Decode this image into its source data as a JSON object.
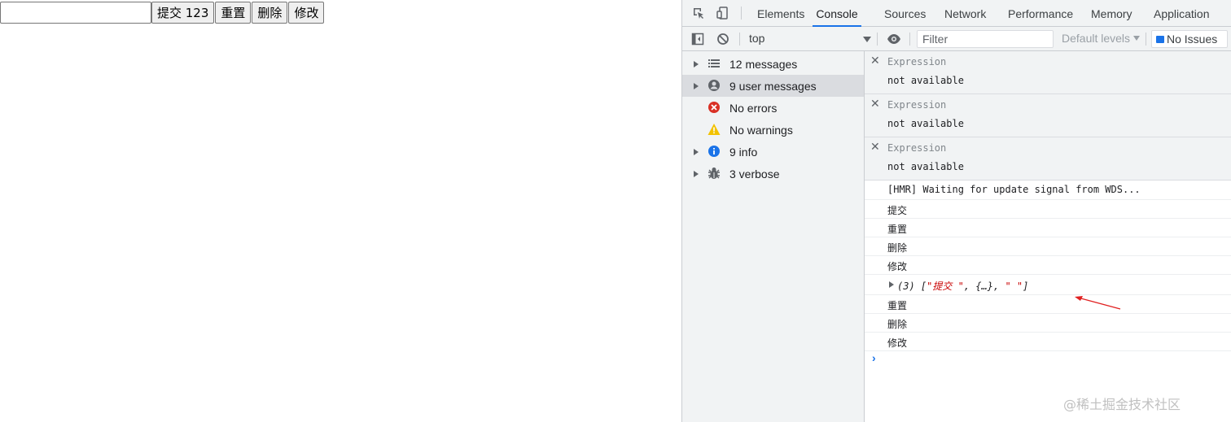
{
  "page": {
    "input_value": "",
    "buttons": [
      "提交 123",
      "重置",
      "删除",
      "修改"
    ]
  },
  "devtools": {
    "tabs": [
      "Elements",
      "Console",
      "Sources",
      "Network",
      "Performance",
      "Memory",
      "Application"
    ],
    "active_tab": "Console",
    "context": "top",
    "filter_placeholder": "Filter",
    "levels_label": "Default levels",
    "issues_label": "No Issues",
    "sidebar": [
      {
        "label": "12 messages",
        "icon": "list-icon",
        "expandable": true
      },
      {
        "label": "9 user messages",
        "icon": "user-icon",
        "expandable": true
      },
      {
        "label": "No errors",
        "icon": "error-icon",
        "expandable": false
      },
      {
        "label": "No warnings",
        "icon": "warning-icon",
        "expandable": false
      },
      {
        "label": "9 info",
        "icon": "info-icon",
        "expandable": true
      },
      {
        "label": "3 verbose",
        "icon": "bug-icon",
        "expandable": true
      }
    ],
    "expressions": [
      {
        "label": "Expression",
        "value": "not available"
      },
      {
        "label": "Expression",
        "value": "not available"
      },
      {
        "label": "Expression",
        "value": "not available"
      }
    ],
    "logs": [
      "[HMR] Waiting for update signal from WDS...",
      "提交",
      "重置",
      "删除",
      "修改",
      "",
      "重置",
      "删除",
      "修改"
    ],
    "array_log": {
      "count": "(3)",
      "open": "[",
      "item1": "\"提交 \"",
      "sep1": ", ",
      "item2": "{…}",
      "sep2": ", ",
      "item3": "\" \"",
      "close": "]"
    },
    "prompt": "›"
  },
  "watermark": "@稀土掘金技术社区",
  "colors": {
    "accent": "#1a73e8",
    "error": "#d93025",
    "warning": "#f2c200",
    "annotation_arrow": "#e02020"
  }
}
